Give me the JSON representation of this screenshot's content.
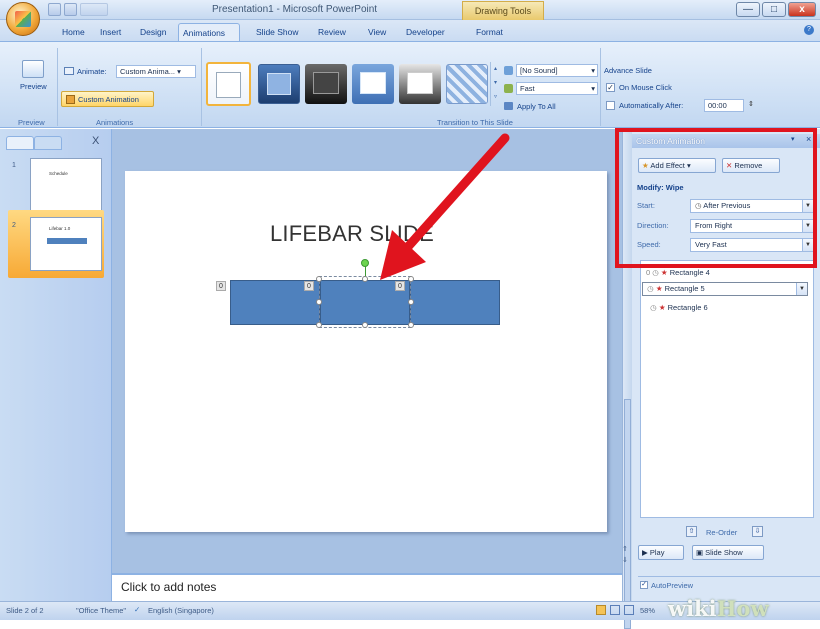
{
  "window": {
    "title": "Presentation1 - Microsoft PowerPoint",
    "contextual_tab_group": "Drawing Tools",
    "minimize": "—",
    "maximize": "□",
    "close": "x"
  },
  "tabs": [
    "Home",
    "Insert",
    "Design",
    "Animations",
    "Slide Show",
    "Review",
    "View",
    "Developer",
    "Format"
  ],
  "active_tab": "Animations",
  "ribbon": {
    "preview_group": {
      "button": "Preview",
      "label": "Preview"
    },
    "animations_group": {
      "animate_label": "Animate:",
      "animate_value": "Custom Anima...",
      "custom_animation_button": "Custom Animation",
      "label": "Animations"
    },
    "transition_group": {
      "sound_value": "[No Sound]",
      "speed_value": "Fast",
      "apply_to_all": "Apply To All",
      "label": "Transition to This Slide"
    },
    "advance_group": {
      "title": "Advance Slide",
      "on_mouse_click": "On Mouse Click",
      "on_mouse_click_checked": true,
      "auto_after": "Automatically After:",
      "auto_after_value": "00:00",
      "auto_after_checked": false
    }
  },
  "slides_pane": {
    "close": "X",
    "slides": [
      {
        "number": "1",
        "caption": "Schedule"
      },
      {
        "number": "2",
        "caption": "Lifebar 1.0"
      }
    ]
  },
  "slide": {
    "title": "LIFEBAR SLIDE",
    "tag_numbers": [
      "0",
      "0",
      "0"
    ]
  },
  "notes": {
    "placeholder": "Click to add notes"
  },
  "task_pane": {
    "title": "Custom Animation",
    "add_effect": "Add Effect",
    "remove": "Remove",
    "modify": "Modify: Wipe",
    "start_label": "Start:",
    "start_value": "After Previous",
    "direction_label": "Direction:",
    "direction_value": "From Right",
    "speed_label": "Speed:",
    "speed_value": "Very Fast",
    "animation_items": [
      {
        "label": "Rectangle 4"
      },
      {
        "label": "Rectangle 5"
      },
      {
        "label": "Rectangle 6"
      }
    ],
    "reorder": "Re-Order",
    "play": "Play",
    "slide_show": "Slide Show",
    "autopreview": "AutoPreview",
    "autopreview_checked": true
  },
  "status": {
    "slide": "Slide 2 of 2",
    "theme": "\"Office Theme\"",
    "language": "English (Singapore)",
    "zoom": "58%"
  },
  "watermark": {
    "wiki": "wiki",
    "how": "How"
  },
  "colors": {
    "highlight_red": "#e0141e",
    "shape_blue": "#4f81bd",
    "ribbon_blue": "#cddff4"
  }
}
